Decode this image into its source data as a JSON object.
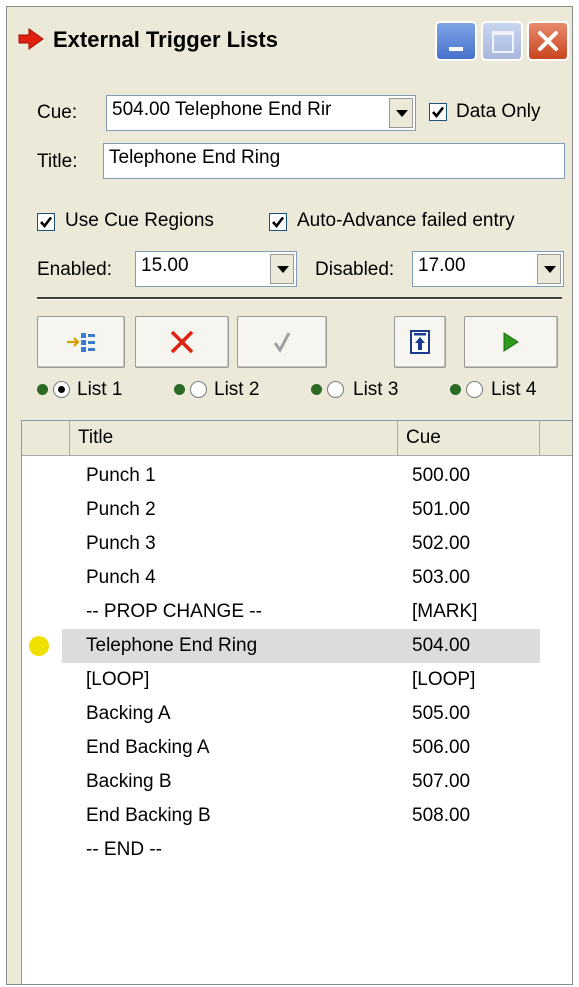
{
  "window": {
    "title": "External Trigger Lists"
  },
  "cue": {
    "label": "Cue:",
    "value": "504.00  Telephone End Rir",
    "data_only_label": "Data Only",
    "data_only_checked": true
  },
  "title_field": {
    "label": "Title:",
    "value": "Telephone End Ring"
  },
  "options": {
    "use_cue_regions_label": "Use Cue Regions",
    "auto_advance_label": "Auto-Advance failed entry"
  },
  "range": {
    "enabled_label": "Enabled:",
    "enabled_value": "15.00",
    "disabled_label": "Disabled:",
    "disabled_value": "17.00"
  },
  "lists": [
    {
      "label": "List 1",
      "selected": true
    },
    {
      "label": "List 2",
      "selected": false
    },
    {
      "label": "List 3",
      "selected": false
    },
    {
      "label": "List 4",
      "selected": false
    }
  ],
  "table": {
    "columns": [
      "Title",
      "Cue"
    ],
    "rows": [
      {
        "title": "Punch 1",
        "cue": "500.00"
      },
      {
        "title": "Punch 2",
        "cue": "501.00"
      },
      {
        "title": "Punch 3",
        "cue": "502.00"
      },
      {
        "title": "Punch 4",
        "cue": "503.00"
      },
      {
        "title": "-- PROP CHANGE --",
        "cue": "[MARK]"
      },
      {
        "title": "Telephone End Ring",
        "cue": "504.00",
        "current": true
      },
      {
        "title": "[LOOP]",
        "cue": "[LOOP]"
      },
      {
        "title": "Backing A",
        "cue": "505.00"
      },
      {
        "title": "End Backing A",
        "cue": "506.00"
      },
      {
        "title": "Backing B",
        "cue": "507.00"
      },
      {
        "title": "End Backing B",
        "cue": "508.00"
      },
      {
        "title": "-- END --",
        "cue": ""
      }
    ]
  },
  "colors": {
    "accent_red": "#e02010",
    "status_green": "#2a6a24",
    "current_marker": "#f0e000"
  }
}
